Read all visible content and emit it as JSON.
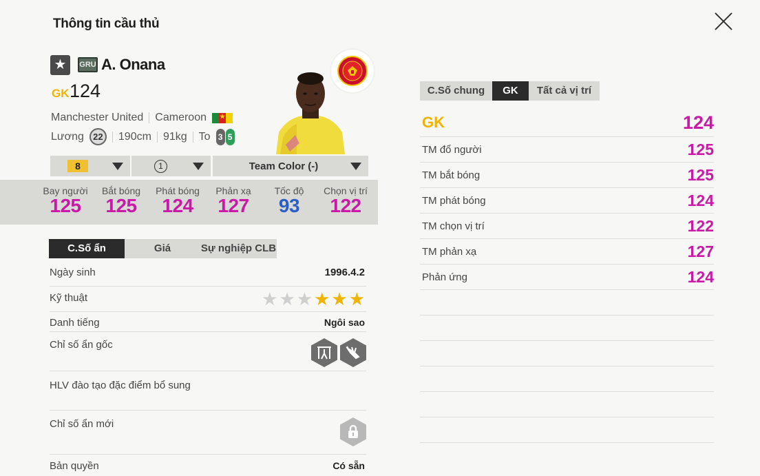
{
  "header": {
    "title": "Thông tin cầu thủ"
  },
  "player": {
    "star_icon": "★",
    "season_badge": "GRU",
    "name": "A. Onana",
    "position": "GK",
    "ovr": "124",
    "club": "Manchester United",
    "nation": "Cameroon",
    "wage_label": "Lương",
    "wage": "22",
    "height": "190cm",
    "weight": "91kg",
    "build": "To",
    "weak_foot_left": "3",
    "weak_foot_right": "5"
  },
  "dropdowns": {
    "level": "8",
    "team_level": "1",
    "team_color": "Team Color (-)"
  },
  "stats": [
    {
      "label": "Bay người",
      "value": "125"
    },
    {
      "label": "Bắt bóng",
      "value": "125"
    },
    {
      "label": "Phát bóng",
      "value": "124"
    },
    {
      "label": "Phản xạ",
      "value": "127"
    },
    {
      "label": "Tốc độ",
      "value": "93"
    },
    {
      "label": "Chọn vị trí",
      "value": "122"
    }
  ],
  "left_tabs": [
    "C.Số ẩn",
    "Giá",
    "Sự nghiệp CLB"
  ],
  "details": {
    "birth_label": "Ngày sinh",
    "birth": "1996.4.2",
    "skill_label": "Kỹ thuật",
    "skill_stars": 3,
    "skill_max": 6,
    "fame_label": "Danh tiếng",
    "fame": "Ngôi sao",
    "traits_label": "Chỉ số ẩn gốc",
    "trainer_label": "HLV đào tạo đặc điểm bổ sung",
    "new_traits_label": "Chỉ số ẩn mới",
    "license_label": "Bản quyền",
    "license": "Có sẵn"
  },
  "right_tabs": [
    "C.Số chung",
    "GK",
    "Tất cả vị trí"
  ],
  "position_stats": [
    {
      "label": "GK",
      "value": "124"
    },
    {
      "label": "TM đổ người",
      "value": "125"
    },
    {
      "label": "TM bắt bóng",
      "value": "125"
    },
    {
      "label": "TM phát bóng",
      "value": "124"
    },
    {
      "label": "TM chọn vị trí",
      "value": "122"
    },
    {
      "label": "TM phản xạ",
      "value": "127"
    },
    {
      "label": "Phản ứng",
      "value": "124"
    }
  ],
  "colors": {
    "accent_gold": "#f0b400",
    "stat_magenta": "#c81aa6",
    "stat_blue": "#2a5fc8"
  },
  "icons": [
    "close-icon",
    "star-icon",
    "club-crest-icon",
    "flag-cameroon-icon",
    "foot-icon",
    "chevron-down-icon",
    "trait-gk-icon",
    "trait-glove-icon",
    "lock-icon"
  ]
}
